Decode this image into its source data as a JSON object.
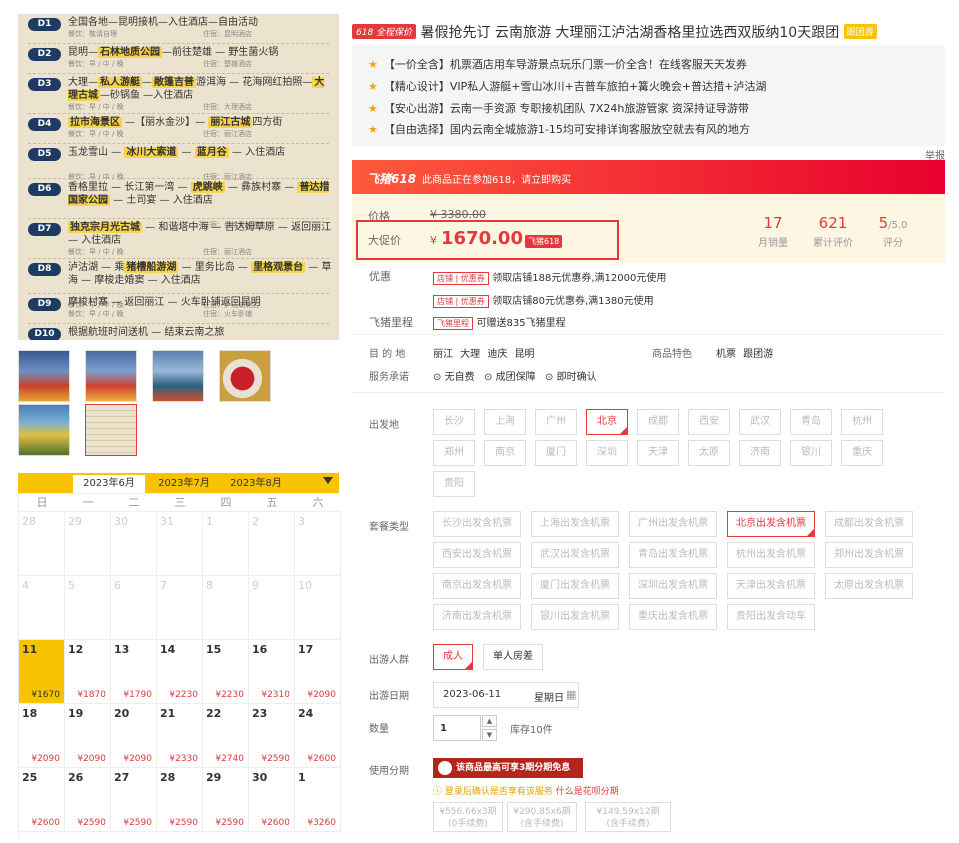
{
  "itinerary": {
    "days": [
      {
        "badge": "D1",
        "route": [
          {
            "t": "全国各地—昆明接机—入住酒店—自由活动"
          }
        ],
        "meal": "餐饮：敬请自理",
        "stay": "住宿：昆明酒店"
      },
      {
        "badge": "D2",
        "route": [
          {
            "t": "昆明—"
          },
          {
            "t": "石林地质公园",
            "hl": true
          },
          {
            "t": "—前往楚雄 — 野生菌火锅"
          }
        ],
        "meal": "餐饮：早 / 中 / 晚",
        "stay": "住宿：楚雄酒店"
      },
      {
        "badge": "D3",
        "route": [
          {
            "t": "大理—"
          },
          {
            "t": "私人游艇",
            "hl": true
          },
          {
            "t": "—"
          },
          {
            "t": "敞篷吉普",
            "hl": true
          },
          {
            "t": "游洱海 — 花海网红拍照—"
          },
          {
            "t": "大理古城",
            "hl": true
          },
          {
            "t": "—砂锅鱼 —入住酒店"
          }
        ],
        "meal": "餐饮：早 / 中 / 晚",
        "stay": "住宿：大理酒店"
      },
      {
        "badge": "D4",
        "route": [
          {
            "t": "拉市海景区",
            "hl": true
          },
          {
            "t": " —【丽水金沙】— "
          },
          {
            "t": "丽江古城",
            "hl": true
          },
          {
            "t": "四方街"
          }
        ],
        "meal": "餐饮：早 / 中 / 晚",
        "stay": "住宿：丽江酒店"
      },
      {
        "badge": "D5",
        "route": [
          {
            "t": "玉龙雪山 — "
          },
          {
            "t": "冰川大索道",
            "hl": true
          },
          {
            "t": " — "
          },
          {
            "t": "蓝月谷",
            "hl": true
          },
          {
            "t": " — 入住酒店"
          }
        ],
        "meal": "餐饮：早 / 中 / 晚",
        "stay": "住宿：丽江酒店"
      },
      {
        "badge": "D6",
        "route": [
          {
            "t": "香格里拉 — 长江第一湾 — "
          },
          {
            "t": "虎跳峡",
            "hl": true
          },
          {
            "t": " — 彝族村寨 — "
          },
          {
            "t": "普达措国家公园",
            "hl": true
          },
          {
            "t": " — 土司宴 — 入住酒店"
          }
        ],
        "meal": "餐饮：早 / 中 / 晚",
        "stay": "住宿：香格里拉酒店"
      },
      {
        "badge": "D7",
        "route": [
          {
            "t": "独克宗月光古城",
            "hl": true
          },
          {
            "t": " — 和谐塔中海 — 吉达姆草原 — 返回丽江 — 入住酒店"
          }
        ],
        "meal": "餐饮：早 / 中 / 晚",
        "stay": "住宿：丽江酒店"
      },
      {
        "badge": "D8",
        "route": [
          {
            "t": "泸沽湖 — 乘"
          },
          {
            "t": "猪槽船游湖",
            "hl": true
          },
          {
            "t": " — 里务比岛 — "
          },
          {
            "t": "里格观景台",
            "hl": true
          },
          {
            "t": " — 草海 — 摩梭走婚窦 — 入住酒店"
          }
        ],
        "meal": "餐饮：早 / 中 / 晚",
        "stay": "住宿：泸沽湖酒店"
      },
      {
        "badge": "D9",
        "route": [
          {
            "t": "摩梭村寨 — 返回丽江 — 火车卧铺返回昆明"
          }
        ],
        "meal": "餐饮：早 / 中 / 晚",
        "stay": "住宿：火车卧铺"
      },
      {
        "badge": "D10",
        "route": [
          {
            "t": "根据航班时间送机 — 结束云南之旅"
          }
        ],
        "meal": "",
        "stay": ""
      }
    ]
  },
  "calendar": {
    "months": [
      "2023年6月",
      "2023年7月",
      "2023年8月"
    ],
    "weekdays": [
      "日",
      "一",
      "二",
      "三",
      "四",
      "五",
      "六"
    ],
    "weeks": [
      [
        {
          "d": "28",
          "dim": true
        },
        {
          "d": "29",
          "dim": true
        },
        {
          "d": "30",
          "dim": true
        },
        {
          "d": "31",
          "dim": true
        },
        {
          "d": "1",
          "dim": true
        },
        {
          "d": "2",
          "dim": true
        },
        {
          "d": "3",
          "dim": true
        }
      ],
      [
        {
          "d": "4",
          "dim": true
        },
        {
          "d": "5",
          "dim": true
        },
        {
          "d": "6",
          "dim": true
        },
        {
          "d": "7",
          "dim": true
        },
        {
          "d": "8",
          "dim": true
        },
        {
          "d": "9",
          "dim": true
        },
        {
          "d": "10",
          "dim": true
        }
      ],
      [
        {
          "d": "11",
          "p": "¥1670",
          "today": true
        },
        {
          "d": "12",
          "p": "¥1870"
        },
        {
          "d": "13",
          "p": "¥1790"
        },
        {
          "d": "14",
          "p": "¥2230"
        },
        {
          "d": "15",
          "p": "¥2230"
        },
        {
          "d": "16",
          "p": "¥2310"
        },
        {
          "d": "17",
          "p": "¥2090"
        }
      ],
      [
        {
          "d": "18",
          "p": "¥2090"
        },
        {
          "d": "19",
          "p": "¥2090"
        },
        {
          "d": "20",
          "p": "¥2090"
        },
        {
          "d": "21",
          "p": "¥2330"
        },
        {
          "d": "22",
          "p": "¥2740"
        },
        {
          "d": "23",
          "p": "¥2590"
        },
        {
          "d": "24",
          "p": "¥2600"
        }
      ],
      [
        {
          "d": "25",
          "p": "¥2600"
        },
        {
          "d": "26",
          "p": "¥2590"
        },
        {
          "d": "27",
          "p": "¥2590"
        },
        {
          "d": "28",
          "p": "¥2590"
        },
        {
          "d": "29",
          "p": "¥2590"
        },
        {
          "d": "30",
          "p": "¥2600"
        },
        {
          "d": "1",
          "p": "¥3260"
        }
      ]
    ]
  },
  "product": {
    "tag618": "618 全程保价",
    "title": "暑假抢先订 云南旅游 大理丽江泸沽湖香格里拉选西双版纳10天跟团",
    "team_tag": "跟团游",
    "features": [
      "【一价全含】机票酒店用车导游景点玩乐门票一价全含！在线客服天天发券",
      "【精心设计】VIP私人游艇+雪山冰川+吉普车旅拍+篝火晚会+普达措+泸沽湖",
      "【安心出游】云南一手资源 专职接机团队 7X24h旅游管家 资深持证导游带",
      "【自由选择】国内云南全城旅游1-15均可安排详询客服放空就去有风的地方"
    ],
    "report": "举报",
    "promo_logo": "飞猪618",
    "promo_text": "此商品正在参加618，请立即购买"
  },
  "price": {
    "orig_label": "价格",
    "orig_value": "¥ 3380.00",
    "sale_label": "大促价",
    "currency": "¥",
    "sale_value": "1670.00",
    "sale_tag": "飞猪618",
    "stats": [
      {
        "v": "17",
        "sub": "",
        "l": "月销量"
      },
      {
        "v": "621",
        "sub": "",
        "l": "累计评价"
      },
      {
        "v": "5",
        "sub": "/5.0",
        "l": "评分"
      }
    ]
  },
  "coupons": {
    "label": "优惠",
    "items": [
      {
        "tag": "店铺 | 优惠券",
        "text": "领取店铺188元优惠券,满12000元使用"
      },
      {
        "tag": "店铺 | 优惠券",
        "text": "领取店铺80元优惠券,满1380元使用"
      }
    ]
  },
  "miles": {
    "label": "飞猪里程",
    "tag": "飞猪里程",
    "text": "可赠送835飞猪里程"
  },
  "destination": {
    "label": "目 的 地",
    "values": "丽江  大理  迪庆  昆明",
    "feat_label": "商品特色",
    "feat_values": "机票  跟团游"
  },
  "service": {
    "label": "服务承诺",
    "items": [
      "无自费",
      "成团保障",
      "即时确认"
    ]
  },
  "departure": {
    "label": "出发地",
    "cities": [
      "长沙",
      "上海",
      "广州",
      "北京",
      "成都",
      "西安",
      "武汉",
      "青岛",
      "杭州",
      "郑州",
      "南京",
      "厦门",
      "深圳",
      "天津",
      "太原",
      "济南",
      "银川",
      "重庆",
      "贵阳"
    ],
    "selected": "北京"
  },
  "package": {
    "label": "套餐类型",
    "items": [
      "长沙出发含机票",
      "上海出发含机票",
      "广州出发含机票",
      "北京出发含机票",
      "成都出发含机票",
      "西安出发含机票",
      "武汉出发含机票",
      "青岛出发含机票",
      "杭州出发含机票",
      "郑州出发含机票",
      "南京出发含机票",
      "厦门出发含机票",
      "深圳出发含机票",
      "天津出发含机票",
      "太原出发含机票",
      "济南出发含机票",
      "银川出发含机票",
      "重庆出发含机票",
      "贵阳出发含动车"
    ],
    "selected": "北京出发含机票"
  },
  "people": {
    "label": "出游人群",
    "adult": "成人",
    "single": "单人房差"
  },
  "date": {
    "label": "出游日期",
    "value": "2023-06-11",
    "weekday": "星期日"
  },
  "qty": {
    "label": "数量",
    "value": "1",
    "stock": "库存10件"
  },
  "installment": {
    "label": "使用分期",
    "banner": "该商品最高可享3期分期免息",
    "notice": "登录后确认是否享有该服务",
    "link": "什么是花呗分期",
    "plans": [
      {
        "a": "¥556.66x3期",
        "b": "(0手续费)"
      },
      {
        "a": "¥290.85x6期",
        "b": "(含手续费)"
      },
      {
        "a": "¥149.59x12期",
        "b": "(含手续费)"
      }
    ]
  },
  "colors": {
    "accent": "#e4393c",
    "yellow": "#f8c300",
    "navy": "#1d3b63"
  }
}
